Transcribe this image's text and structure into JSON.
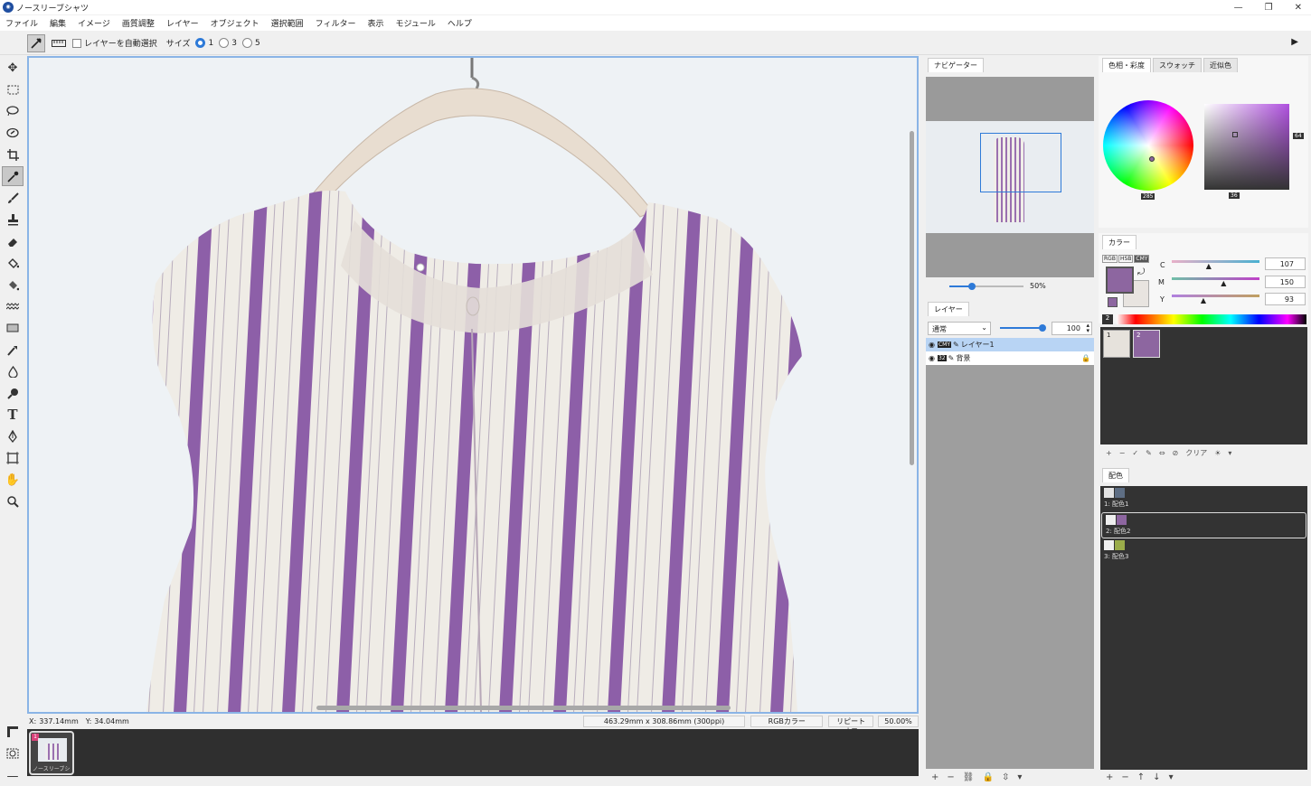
{
  "titlebar": {
    "title": "ノースリーブシャツ",
    "app_icon": "app-logo-icon"
  },
  "window_controls": {
    "minimize": "—",
    "restore": "❐",
    "close": "✕"
  },
  "menu": [
    "ファイル",
    "編集",
    "イメージ",
    "画質調整",
    "レイヤー",
    "オブジェクト",
    "選択範囲",
    "フィルター",
    "表示",
    "モジュール",
    "ヘルプ"
  ],
  "options": {
    "auto_select_label": "レイヤーを自動選択",
    "size_label": "サイズ",
    "sizes": [
      "1",
      "3",
      "5"
    ],
    "selected_size": "1"
  },
  "tools": [
    "move-tool-icon",
    "rect-select-icon",
    "lasso-icon",
    "auto-select-icon",
    "crop-icon",
    "eyedropper-icon",
    "brush-icon",
    "stamp-icon",
    "eraser-icon",
    "bucket-icon",
    "gradient-bucket-icon",
    "pattern-icon",
    "shape-icon",
    "smudge-icon",
    "blur-drop-icon",
    "dodge-icon",
    "text-icon",
    "pen-icon",
    "transform-icon",
    "hand-icon",
    "zoom-icon"
  ],
  "status": {
    "x_label": "X:",
    "x_value": "337.14mm",
    "y_label": "Y:",
    "y_value": "34.04mm",
    "doc_size": "463.29mm x 308.86mm (300ppi)",
    "color_mode": "RGBカラー",
    "repeat": "リピートオフ",
    "zoom": "50.00%"
  },
  "film": {
    "thumb_label": "ノースリーブシ",
    "badge": "1"
  },
  "navigator": {
    "tab": "ナビゲーター",
    "zoom_value": "50%",
    "zoom_fraction": 0.3
  },
  "layers": {
    "tab": "レイヤー",
    "blend_mode": "通常",
    "opacity": "100",
    "opacity_fraction": 0.93,
    "rows": [
      {
        "name": "レイヤー1",
        "badge": "CMY",
        "selected": true
      },
      {
        "name": "背景",
        "badge": "32",
        "selected": false,
        "locked": true
      }
    ],
    "bottom_icons": [
      "+",
      "−",
      "⛓",
      "🔒",
      "⇳",
      "▾"
    ]
  },
  "color": {
    "tabs": [
      "色相・彩度",
      "スウォッチ",
      "近似色"
    ],
    "hue_readout": "285",
    "sat_readout": "36",
    "val_readout": "64",
    "picked_color": "#8d66a0"
  },
  "cmyk": {
    "tab": "カラー",
    "modes": [
      "RGB",
      "HSB",
      "CMY"
    ],
    "channels": [
      {
        "label": "C",
        "value": "107",
        "pos": 0.43
      },
      {
        "label": "M",
        "value": "150",
        "pos": 0.6
      },
      {
        "label": "Y",
        "value": "93",
        "pos": 0.37
      }
    ],
    "foreground": "#8d66a0",
    "background": "#e8e4e0",
    "spectrum_badge": "2"
  },
  "swatches": {
    "items": [
      {
        "index": "1",
        "color": "#e6e2dc"
      },
      {
        "index": "2",
        "color": "#8d66a0"
      }
    ],
    "toolbar": [
      "+",
      "−",
      "✓",
      "✎",
      "⇔",
      "⊘",
      "クリア",
      "☀",
      "▾"
    ]
  },
  "haishoku": {
    "tab": "配色",
    "rows": [
      {
        "label": "1: 配色1",
        "colors": [
          "#e3e3e3",
          "#5e6e84"
        ]
      },
      {
        "label": "2: 配色2",
        "colors": [
          "#eeeeee",
          "#8d66a0"
        ]
      },
      {
        "label": "3: 配色3",
        "colors": [
          "#f0f0f0",
          "#9aac4a"
        ]
      }
    ],
    "bottom_icons": [
      "+",
      "−",
      "↑",
      "↓",
      "▾"
    ]
  },
  "accent": "#2e7ad8"
}
